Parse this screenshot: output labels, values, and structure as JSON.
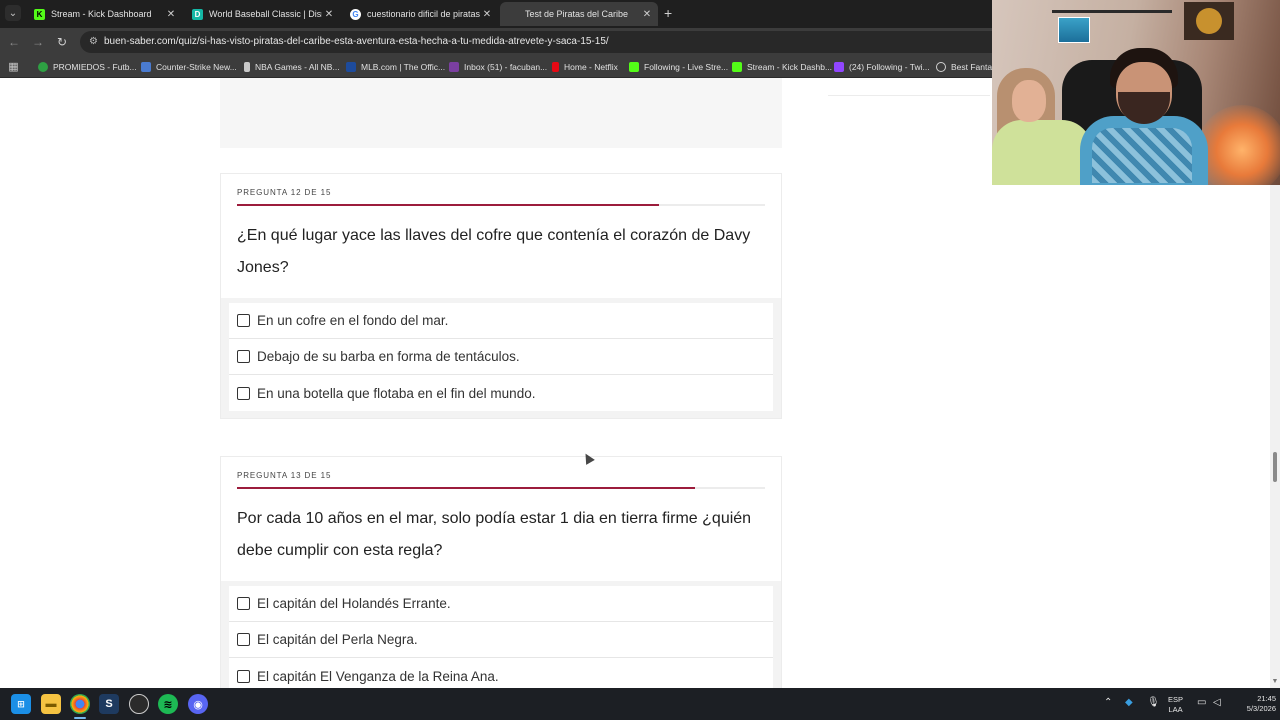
{
  "browser": {
    "tabs": [
      {
        "title": "Stream - Kick Dashboard",
        "favicon_color": "#53fc18",
        "favicon_glyph": "K"
      },
      {
        "title": "World Baseball Classic | Disney",
        "favicon_color": "#14b8a6",
        "favicon_glyph": "D"
      },
      {
        "title": "cuestionario dificil de piratas d",
        "favicon_color": "#ffffff",
        "favicon_glyph": "G"
      },
      {
        "title": "Test de Piratas del Caribe",
        "favicon_color": "#9c1c3c",
        "favicon_glyph": ""
      }
    ],
    "active_tab_index": 3,
    "url": "buen-saber.com/quiz/si-has-visto-piratas-del-caribe-esta-aventura-esta-hecha-a-tu-medida-atrevete-y-saca-15-15/",
    "bookmarks": [
      {
        "label": "PROMIEDOS - Futb...",
        "color": "#2ea043"
      },
      {
        "label": "Counter-Strike New...",
        "color": "#4a7bd0"
      },
      {
        "label": "NBA Games - All NB...",
        "color": "#c9c9c9"
      },
      {
        "label": "MLB.com | The Offic...",
        "color": "#1d4b9c"
      },
      {
        "label": "Inbox (51) - facuban...",
        "color": "#7b3fa0"
      },
      {
        "label": "Home - Netflix",
        "color": "#e50914"
      },
      {
        "label": "Following - Live Stre...",
        "color": "#53fc18"
      },
      {
        "label": "Stream - Kick Dashb...",
        "color": "#53fc18"
      },
      {
        "label": "(24) Following - Twi...",
        "color": "#9146ff"
      },
      {
        "label": "Best Fantas",
        "color": "#d0d0d0"
      }
    ]
  },
  "quiz": {
    "questions": [
      {
        "label": "PREGUNTA 12 DE 15",
        "progress": 0.8,
        "text": "¿En qué lugar yace las llaves del cofre que contenía el corazón de Davy Jones?",
        "options": [
          "En un cofre en el fondo del mar.",
          "Debajo de su barba en forma de tentáculos.",
          "En una botella que flotaba en el fin del mundo."
        ]
      },
      {
        "label": "PREGUNTA 13 DE 15",
        "progress": 0.867,
        "text": "Por cada 10 años en el mar, solo podía estar 1 dia en tierra firme ¿quién debe cumplir con esta regla?",
        "options": [
          "El capitán del Holandés Errante.",
          "El capitán del Perla Negra.",
          "El capitán El Venganza de la Reina Ana."
        ]
      }
    ]
  },
  "taskbar": {
    "language": "ESP",
    "layout": "LAA",
    "time": "21:45",
    "date": "5/3/2026"
  }
}
